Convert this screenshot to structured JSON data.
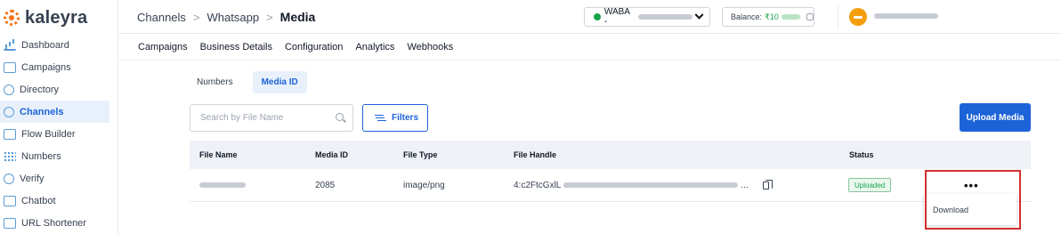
{
  "brand": {
    "name": "kaleyra",
    "accent": "#1d63d8",
    "logo_color": "#f97316"
  },
  "sidebar": {
    "items": [
      {
        "label": "Dashboard",
        "icon": "dashboard-icon"
      },
      {
        "label": "Campaigns",
        "icon": "megaphone-icon"
      },
      {
        "label": "Directory",
        "icon": "contact-icon"
      },
      {
        "label": "Channels",
        "icon": "channels-icon",
        "active": true
      },
      {
        "label": "Flow Builder",
        "icon": "flow-icon"
      },
      {
        "label": "Numbers",
        "icon": "dialpad-icon"
      },
      {
        "label": "Verify",
        "icon": "shield-icon"
      },
      {
        "label": "Chatbot",
        "icon": "chatbot-icon"
      },
      {
        "label": "URL Shortener",
        "icon": "link-icon"
      }
    ]
  },
  "header": {
    "breadcrumb": [
      "Channels",
      "Whatsapp",
      "Media"
    ],
    "separator": ">",
    "waba_prefix": "WABA -",
    "balance_prefix": "Balance: ",
    "balance_value_visible": "₹10"
  },
  "subnav": [
    "Campaigns",
    "Business Details",
    "Configuration",
    "Analytics",
    "Webhooks"
  ],
  "tabs": [
    {
      "label": "Numbers",
      "active": false
    },
    {
      "label": "Media ID",
      "active": true
    }
  ],
  "search": {
    "placeholder": "Search by File Name"
  },
  "filters_label": "Filters",
  "upload_label": "Upload Media",
  "table": {
    "headers": [
      "File Name",
      "Media ID",
      "File Type",
      "File Handle",
      "Status"
    ],
    "rows": [
      {
        "media_id": "2085",
        "file_type": "image/png",
        "file_handle_prefix": "4:c2FtcGxlL",
        "file_handle_suffix": "...",
        "status": "Uploaded"
      }
    ]
  },
  "row_menu": {
    "kebab": "•••",
    "items": [
      "Download"
    ]
  }
}
